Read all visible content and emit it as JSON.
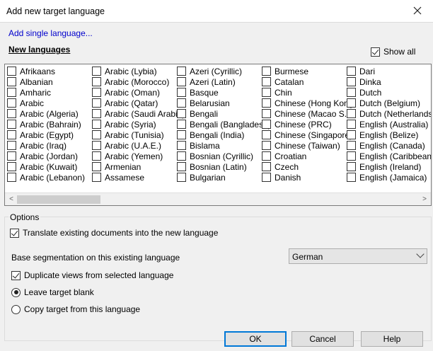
{
  "window": {
    "title": "Add new target language"
  },
  "add_single_language": "Add single language...",
  "new_languages": {
    "label": "New languages"
  },
  "show_all": {
    "label": "Show all",
    "checked": true
  },
  "languages": {
    "columns": [
      [
        "Afrikaans",
        "Albanian",
        "Amharic",
        "Arabic",
        "Arabic (Algeria)",
        "Arabic (Bahrain)",
        "Arabic (Egypt)",
        "Arabic (Iraq)",
        "Arabic (Jordan)",
        "Arabic (Kuwait)",
        "Arabic (Lebanon)"
      ],
      [
        "Arabic (Lybia)",
        "Arabic (Morocco)",
        "Arabic (Oman)",
        "Arabic (Qatar)",
        "Arabic (Saudi Arabia)",
        "Arabic (Syria)",
        "Arabic (Tunisia)",
        "Arabic (U.A.E.)",
        "Arabic (Yemen)",
        "Armenian",
        "Assamese"
      ],
      [
        "Azeri (Cyrillic)",
        "Azeri (Latin)",
        "Basque",
        "Belarusian",
        "Bengali",
        "Bengali (Bangladesh)",
        "Bengali (India)",
        "Bislama",
        "Bosnian (Cyrillic)",
        "Bosnian (Latin)",
        "Bulgarian"
      ],
      [
        "Burmese",
        "Catalan",
        "Chin",
        "Chinese (Hong Kong",
        "Chinese (Macao S.A.",
        "Chinese (PRC)",
        "Chinese (Singapore)",
        "Chinese (Taiwan)",
        "Croatian",
        "Czech",
        "Danish"
      ],
      [
        "Dari",
        "Dinka",
        "Dutch",
        "Dutch (Belgium)",
        "Dutch (Netherlands)",
        "English (Australia)",
        "English (Belize)",
        "English (Canada)",
        "English (Caribbean)",
        "English (Ireland)",
        "English (Jamaica)"
      ]
    ]
  },
  "scrollbar": {
    "left_arrow": "<",
    "right_arrow": ">"
  },
  "options": {
    "group_label": "Options",
    "translate_existing": {
      "label": "Translate existing documents into the new language",
      "checked": true
    },
    "base_segmentation": {
      "label": "Base segmentation on this existing language",
      "value": "German"
    },
    "duplicate_views": {
      "label": "Duplicate views from selected language",
      "checked": true
    },
    "leave_blank": {
      "label": "Leave target blank",
      "selected": true
    },
    "copy_target": {
      "label": "Copy target from this language",
      "selected": false
    }
  },
  "buttons": {
    "ok": "OK",
    "cancel": "Cancel",
    "help": "Help"
  },
  "colors": {
    "link": "#0000cc",
    "default_button_border": "#0078d7",
    "dialog_bg": "#f0f0f0"
  }
}
